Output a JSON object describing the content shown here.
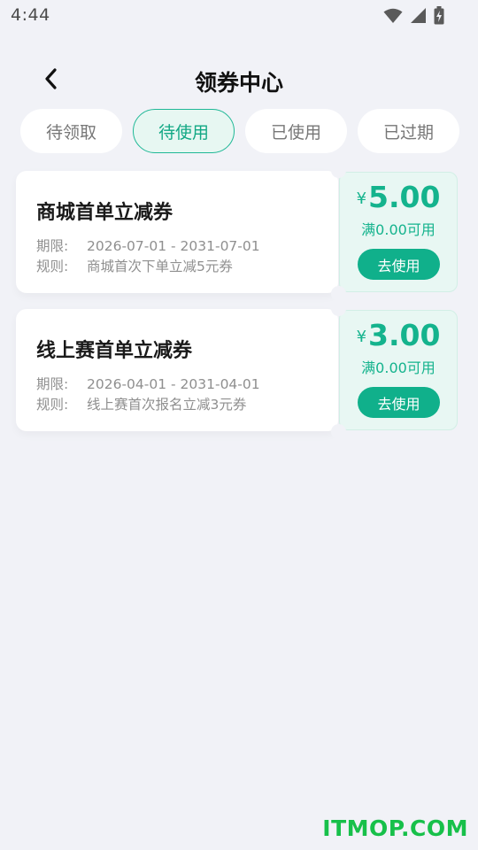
{
  "status_bar": {
    "time": "4:44",
    "icons": [
      "wifi-icon",
      "signal-icon",
      "battery-charging-icon"
    ]
  },
  "header": {
    "title": "领券中心",
    "back_icon": "chevron-left-icon"
  },
  "tabs": [
    {
      "label": "待领取",
      "active": false
    },
    {
      "label": "待使用",
      "active": true
    },
    {
      "label": "已使用",
      "active": false
    },
    {
      "label": "已过期",
      "active": false
    }
  ],
  "coupons": [
    {
      "title": "商城首单立减券",
      "period_label": "期限:",
      "period": "2026-07-01 - 2031-07-01",
      "rule_label": "规则:",
      "rule": "商城首次下单立减5元券",
      "currency": "¥",
      "amount": "5.00",
      "condition": "满0.00可用",
      "button": "去使用"
    },
    {
      "title": "线上赛首单立减券",
      "period_label": "期限:",
      "period": "2026-04-01 - 2031-04-01",
      "rule_label": "规则:",
      "rule": "线上赛首次报名立减3元券",
      "currency": "¥",
      "amount": "3.00",
      "condition": "满0.00可用",
      "button": "去使用"
    }
  ],
  "watermark": "ITMOP.COM",
  "colors": {
    "accent": "#10b08b",
    "background": "#f1f2f7",
    "tab_active_bg": "#e7f7f2",
    "coupon_right_bg": "#e8f7f3"
  }
}
